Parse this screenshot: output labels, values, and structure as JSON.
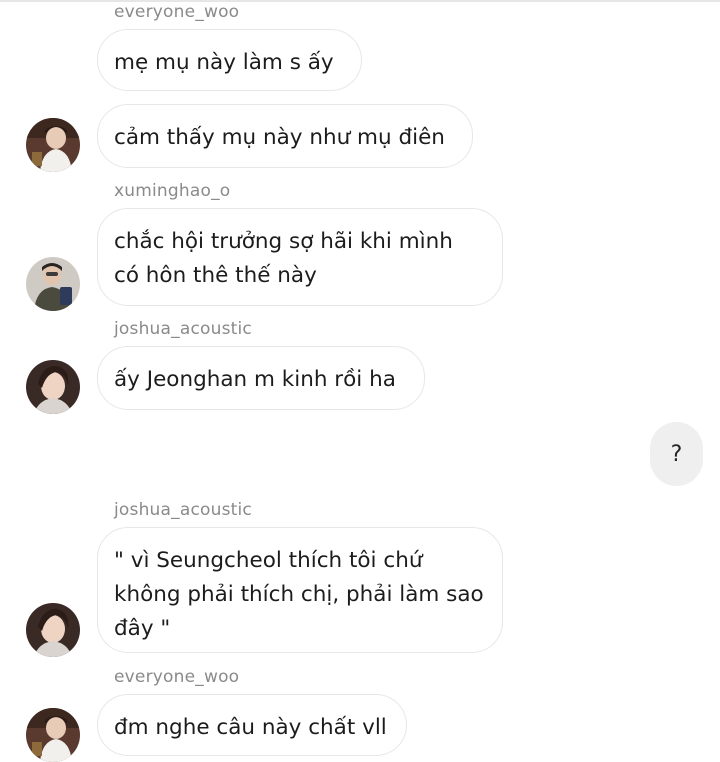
{
  "chat": {
    "messages": [
      {
        "sender": "everyone_woo",
        "text": "mẹ mụ này làm s ấy"
      },
      {
        "sender": "",
        "text": "cảm thấy mụ này như mụ điên"
      },
      {
        "sender": "xuminghao_o",
        "text": "chắc hội trưởng sợ hãi khi mình\ncó hôn thê thế này"
      },
      {
        "sender": "joshua_acoustic",
        "text": "ấy Jeonghan m kinh rồi ha"
      },
      {
        "sender": "",
        "text": "?",
        "own": true
      },
      {
        "sender": "joshua_acoustic",
        "text": "\" vì Seungcheol thích tôi chứ\nkhông phải thích chị, phải làm sao\nđây \""
      },
      {
        "sender": "everyone_woo",
        "text": "đm nghe câu này chất vll"
      }
    ]
  },
  "avatars": {
    "everyone_woo": "avatar-everyone-woo",
    "xuminghao_o": "avatar-xuminghao",
    "joshua_acoustic": "avatar-joshua"
  },
  "colors": {
    "bubble_border": "#e7e7e7",
    "own_bubble": "#efefef",
    "sender_text": "#8a8a8a"
  }
}
